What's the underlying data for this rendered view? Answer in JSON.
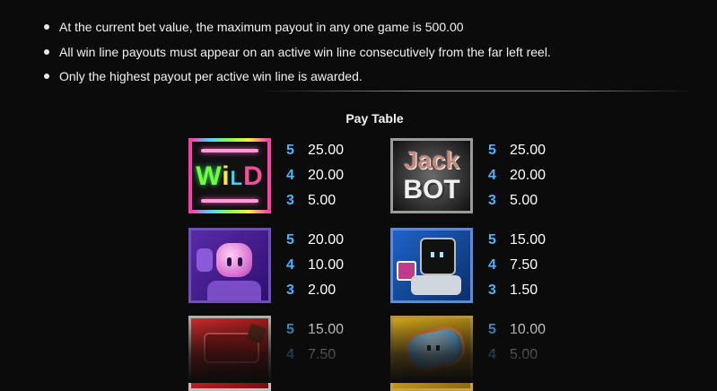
{
  "rules": [
    "At the current bet value, the maximum payout in any one game is 500.00",
    "All win line payouts must appear on an active win line consecutively from the far left reel.",
    "Only the highest payout per active win line is awarded."
  ],
  "pay_table": {
    "title": "Pay Table",
    "symbols": [
      {
        "name": "wild",
        "label": "WILD",
        "icon": "wild-neon-icon",
        "pays": [
          {
            "count": "5",
            "value": "25.00"
          },
          {
            "count": "4",
            "value": "20.00"
          },
          {
            "count": "3",
            "value": "5.00"
          }
        ]
      },
      {
        "name": "jackbot",
        "label_line1": "Jack",
        "label_line2": "BOT",
        "icon": "jackbot-logo-icon",
        "pays": [
          {
            "count": "5",
            "value": "25.00"
          },
          {
            "count": "4",
            "value": "20.00"
          },
          {
            "count": "3",
            "value": "5.00"
          }
        ]
      },
      {
        "name": "purple-robot",
        "icon": "purple-robot-icon",
        "pays": [
          {
            "count": "5",
            "value": "20.00"
          },
          {
            "count": "4",
            "value": "10.00"
          },
          {
            "count": "3",
            "value": "2.00"
          }
        ]
      },
      {
        "name": "blue-robot",
        "icon": "blue-robot-icon",
        "pays": [
          {
            "count": "5",
            "value": "15.00"
          },
          {
            "count": "4",
            "value": "7.50"
          },
          {
            "count": "3",
            "value": "1.50"
          }
        ]
      },
      {
        "name": "red-robot",
        "icon": "red-robot-icon",
        "pays": [
          {
            "count": "5",
            "value": "15.00"
          },
          {
            "count": "4",
            "value": "7.50"
          }
        ]
      },
      {
        "name": "yellow-robot",
        "icon": "yellow-robot-icon",
        "pays": [
          {
            "count": "5",
            "value": "10.00"
          },
          {
            "count": "4",
            "value": "5.00"
          }
        ]
      }
    ]
  },
  "colors": {
    "background": "#0b0b0b",
    "count_accent": "#4fb3ff",
    "text": "#ffffff"
  }
}
